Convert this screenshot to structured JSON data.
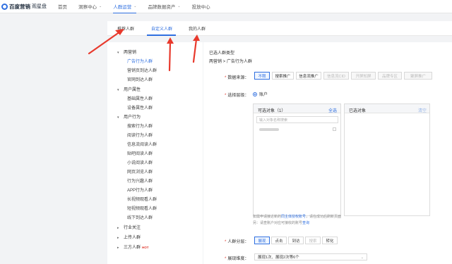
{
  "brand": {
    "name": "百度营销",
    "product": "观星盘"
  },
  "nav": {
    "items": [
      {
        "label": "首页"
      },
      {
        "label": "洞察中心"
      },
      {
        "label": "人群运营"
      },
      {
        "label": "品牌数据资产"
      },
      {
        "label": "投放中心"
      }
    ]
  },
  "subtabs": [
    "推荐人群",
    "自定义人群",
    "我的人群"
  ],
  "sidebar": {
    "groups": [
      {
        "label": "两营销",
        "children": [
          "广告行为人群",
          "营销页到达人群",
          "官网到达人群"
        ]
      },
      {
        "label": "用户属性",
        "children": [
          "基础属性人群",
          "设备属性人群"
        ]
      },
      {
        "label": "用户行为",
        "children": [
          "搜索行为人群",
          "阅读行为人群",
          "信息流阅读人群",
          "贴吧阅读人群",
          "小说阅读人群",
          "网页浏览人群",
          "行为兴趣人群",
          "APP行为人群",
          "长视频观看人群",
          "短视频观看人群",
          "线下到达人群"
        ]
      }
    ],
    "collapsed": [
      "行业关注",
      "上传人群",
      "三方人群"
    ],
    "hot_badge": "HOT"
  },
  "main": {
    "section_title": "已选人群类型",
    "breadcrumb": "两营销 > 广告行为人群",
    "data_source": {
      "label": "数据来源：",
      "options": [
        "不限",
        "搜索推广",
        "信息流推广",
        "信息流CID",
        "开屏知屏",
        "品牌专区",
        "聚屏推广"
      ]
    },
    "level": {
      "label": "选择层级：",
      "value": "账户"
    },
    "selectable": {
      "title": "可选对象（1）",
      "select_all": "全选",
      "search_placeholder": "输入对象名称搜索"
    },
    "selected": {
      "title": "已选对象",
      "clear": "清空"
    },
    "hint1_pre": "如需申请接近新的",
    "hint1_link": "同主体授权账号",
    "hint1_post": "，请在成功后刷新页面",
    "hint2_pre": "另：请查账户对应可接收的账号",
    "hint2_link": "查询",
    "audience_stage": {
      "label": "人群分层：",
      "options": [
        "展现",
        "点击",
        "到访",
        "搜索",
        "转化"
      ]
    },
    "show_dim": {
      "label": "展现维度：",
      "value": "展现1次、展现2次等6个"
    }
  }
}
